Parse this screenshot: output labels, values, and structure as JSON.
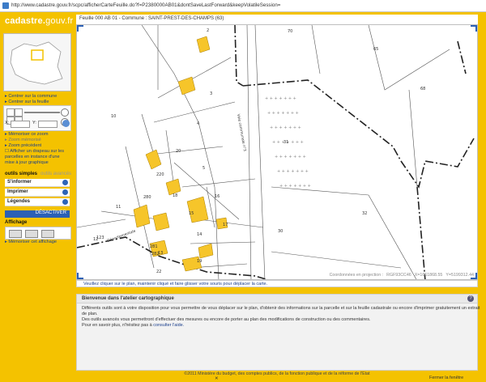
{
  "browser": {
    "url": "http://www.cadastre.gouv.fr/scpc/afficherCarteFeuille.do?f=P2380000AB01&dontSaveLastForward&keepVolatileSession="
  },
  "logo": {
    "text_main": "cadastre.",
    "text_gouv": "gouv.fr"
  },
  "sidebar": {
    "links": {
      "center_commune": "Centrer sur la commune",
      "center_feuille": "Centrer sur la feuille",
      "memoriser_zoom": "Mémoriser ce zoom",
      "zoom_memorise": "Zoom mémorisé",
      "zoom_precedent": "Zoom précédent",
      "drapeau": "Afficher un drapeau sur les parcelles en instance d'une mise à jour graphique"
    },
    "xy": {
      "x_label": "X:",
      "y_label": "Y:"
    },
    "outils": {
      "title": "outils simples",
      "alt": "outils avancés"
    },
    "accordion": [
      "S'informer",
      "Imprimer",
      "Légendes"
    ],
    "desactiver": "DÉSACTIVER",
    "affichage": {
      "title": "Affichage",
      "memoriser": "Mémoriser cet affichage"
    }
  },
  "main": {
    "map_title": "Feuille 000 AB 01 - Commune : SAINT-PREST-DES-CHAMPS (63)",
    "coords": {
      "label": "Coordonnées en projection :",
      "system": "RGF93CC46",
      "x": "X=1661868.55",
      "y": "Y=5199312.44"
    },
    "hint": "Veuillez cliquer sur le plan, maintenir cliqué et faire glisser votre souris pour déplacer la carte.",
    "atelier": {
      "title": "Bienvenue dans l'atelier cartographique",
      "line1": "Différents outils sont à votre disposition pour vous permettre de vous déplacer sur le plan, d'obtenir des informations sur la parcelle et sur la feuille cadastrale ou encore d'imprimer gratuitement un extrait",
      "line1b": "de plan.",
      "line2": "Des outils avancés vous permettront d'effectuer des mesures ou encore de porter au plan des modifications de construction ou des commentaires.",
      "line3": "Pour en savoir plus, n'hésitez pas à",
      "line3_link": "consulter l'aide."
    },
    "map_labels": {
      "parcels": [
        "2",
        "3",
        "4",
        "5",
        "10",
        "11",
        "12",
        "13",
        "14",
        "15",
        "16",
        "17",
        "18",
        "19",
        "20",
        "22",
        "30",
        "31",
        "32",
        "65",
        "68",
        "70",
        "123",
        "220",
        "280",
        "281",
        "282"
      ],
      "roads": [
        "Voie communale n°3",
        "Départementale",
        "départementale"
      ]
    }
  },
  "footer": {
    "copyright": "©2011 Ministère du budget, des comptes publics, de la fonction publique et de la réforme de l'Etat",
    "close": "Fermer la fenêtre"
  },
  "colors": {
    "yellow": "#f4c200",
    "blue": "#2b60b5",
    "building": "#f6c52a"
  }
}
